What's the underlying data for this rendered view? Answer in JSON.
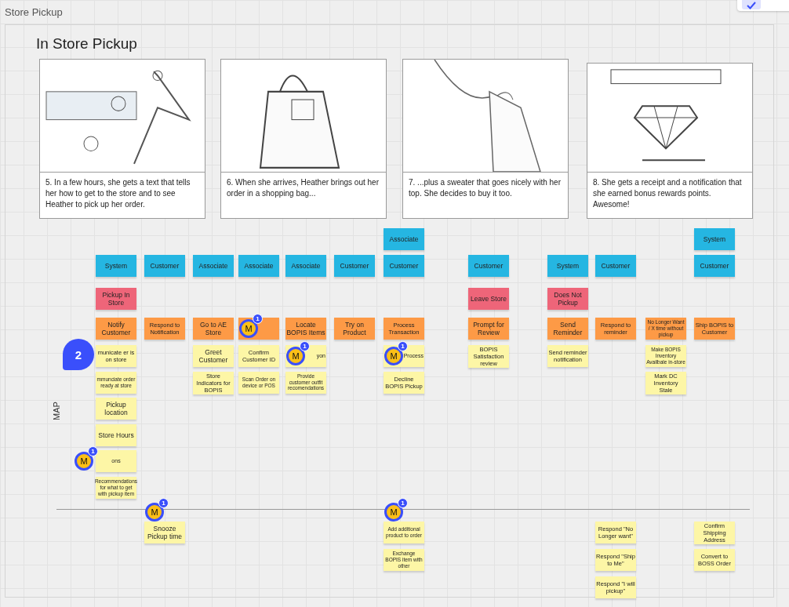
{
  "board": {
    "title": "Store Pickup"
  },
  "frame": {
    "title": "In Store Pickup"
  },
  "storyboard": [
    {
      "caption": "5. In a few hours, she gets a text that tells her how to get to the store and to see Heather to pick up her order."
    },
    {
      "caption": "6. When she arrives, Heather brings out her order in a shopping bag..."
    },
    {
      "caption": "7. ...plus a sweater that goes nicely with her top. She decides to buy it too."
    },
    {
      "caption": "8. She gets a receipt and a notification that she earned bonus rewards points. Awesome!"
    }
  ],
  "side_label": "MAP",
  "columns": [
    {
      "actors": [
        "System"
      ],
      "event": {
        "text": "Pickup In Store"
      },
      "step": {
        "text": "Notify Customer"
      },
      "details": [
        {
          "text": "municate er is on store",
          "comment": {
            "kind": "cluster",
            "count": "2"
          }
        },
        {
          "text": "mmunciate order ready at store"
        },
        {
          "text": "Pickup location"
        },
        {
          "text": "Store Hours"
        },
        {
          "text": "ons",
          "comment": {
            "kind": "avatar",
            "avatar": "M",
            "count": "1"
          }
        },
        {
          "text": "Recommendations for what to get with pickup item"
        }
      ]
    },
    {
      "actors": [
        "Customer"
      ],
      "step": {
        "text": "Respond to Notification"
      },
      "below": [
        {
          "text": "Snooze Pickup time",
          "comment": {
            "kind": "avatar",
            "avatar": "M",
            "count": "1"
          }
        }
      ]
    },
    {
      "actors": [
        "Associate"
      ],
      "step": {
        "text": "Go to AE Store"
      },
      "details": [
        {
          "text": "Greet Customer"
        },
        {
          "text": "Store Indicators for BOPIS"
        }
      ]
    },
    {
      "actors": [
        "Associate"
      ],
      "step": {
        "comment": {
          "kind": "avatar",
          "avatar": "M",
          "count": "1"
        }
      },
      "details": [
        {
          "text": "Confirm Customer ID"
        },
        {
          "text": "Scan Order on device or POS"
        }
      ]
    },
    {
      "actors": [
        "Associate"
      ],
      "step": {
        "text": "Locate BOPIS Items"
      },
      "details": [
        {
          "text": "yon",
          "comment": {
            "kind": "avatar",
            "avatar": "M",
            "count": "1"
          }
        },
        {
          "text": "Provide customer outfit recomendations"
        }
      ]
    },
    {
      "actors": [
        "Customer"
      ],
      "step": {
        "text": "Try on Product"
      }
    },
    {
      "actors": [
        "Associate",
        "Customer"
      ],
      "step": {
        "text": "Process Transaction"
      },
      "details": [
        {
          "text": "Process",
          "comment": {
            "kind": "avatar",
            "avatar": "M",
            "count": "1"
          }
        },
        {
          "text": "Decline BOPIS Pickup"
        }
      ],
      "below": [
        {
          "text": "Add additional product to order",
          "comment": {
            "kind": "avatar",
            "avatar": "M",
            "count": "1"
          }
        },
        {
          "text": "Exchange BOPIS item with other"
        }
      ]
    },
    {
      "actors": [
        "Customer"
      ],
      "event": {
        "text": "Leave Store"
      },
      "step": {
        "text": "Prompt for Review"
      },
      "details": [
        {
          "text": "BOPIS Satisfaction review"
        }
      ]
    },
    {
      "actors": [
        "System"
      ],
      "event": {
        "text": "Does Not Pickup"
      },
      "step": {
        "text": "Send Reminder"
      },
      "details": [
        {
          "text": "Send reminder notification"
        }
      ]
    },
    {
      "actors": [
        "Customer"
      ],
      "step": {
        "text": "Respond to reminder"
      },
      "below": [
        {
          "text": "Respond \"No Longer want\""
        },
        {
          "text": "Respond \"Ship to Me\""
        },
        {
          "text": "Respond \"I will pickup\""
        }
      ]
    },
    {
      "step": {
        "text": "No Longer Want / X time without pickup"
      },
      "details": [
        {
          "text": "Make BOPIS Inventory Availbale in-store"
        },
        {
          "text": "Mark DC Inventory Stale"
        }
      ]
    },
    {
      "actors": [
        "System",
        "Customer"
      ],
      "step": {
        "text": "Ship BOPIS to Customer"
      },
      "below": [
        {
          "text": "Confirm Shipping Address"
        },
        {
          "text": "Convert to BOSS Order"
        }
      ]
    }
  ]
}
